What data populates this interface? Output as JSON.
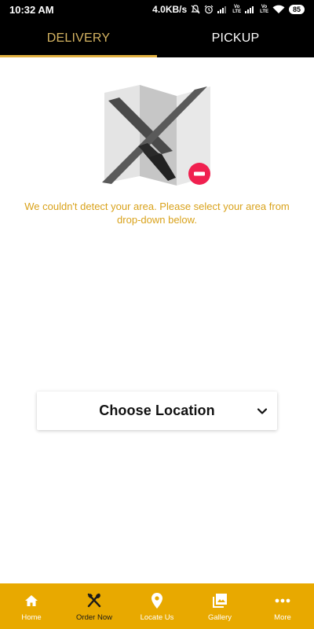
{
  "status_bar": {
    "time": "10:32 AM",
    "speed": "4.0KB/s",
    "volte_top": "Vo",
    "volte_bottom": "LTE",
    "battery": "85"
  },
  "tabs": [
    {
      "label": "DELIVERY",
      "active": true
    },
    {
      "label": "PICKUP",
      "active": false
    }
  ],
  "message": "We couldn't detect your area. Please select your area from drop-down below.",
  "location_select": {
    "label": "Choose Location",
    "icon": "chevron-down-icon"
  },
  "bottom_nav": [
    {
      "label": "Home",
      "icon": "home-icon"
    },
    {
      "label": "Order Now",
      "icon": "utensils-icon",
      "active": true
    },
    {
      "label": "Locate Us",
      "icon": "location-pin-icon"
    },
    {
      "label": "Gallery",
      "icon": "gallery-icon"
    },
    {
      "label": "More",
      "icon": "more-icon"
    }
  ],
  "colors": {
    "tab_active": "#d4b361",
    "indicator": "#e1b040",
    "message": "#d9a21b",
    "nav_background": "#e8a900",
    "error_badge": "#f0204f"
  }
}
